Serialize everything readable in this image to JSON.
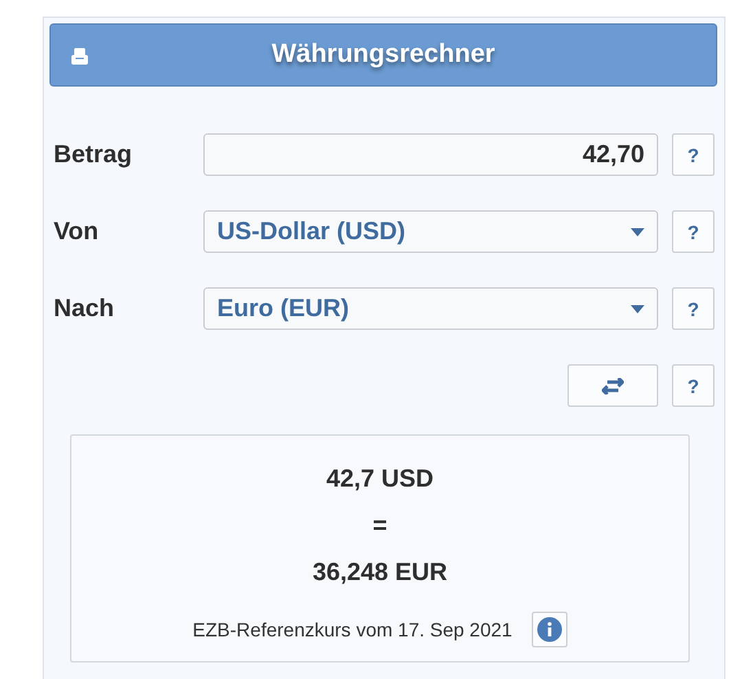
{
  "header": {
    "title": "Währungsrechner"
  },
  "fields": [
    {
      "kind": "input",
      "label": "Betrag",
      "value": "42,70",
      "help": "?"
    },
    {
      "kind": "select",
      "label": "Von",
      "value": "US-Dollar (USD)",
      "help": "?"
    },
    {
      "kind": "select",
      "label": "Nach",
      "value": "Euro (EUR)",
      "help": "?"
    }
  ],
  "swap": {
    "help": "?"
  },
  "result": {
    "from": "42,7 USD",
    "equals": "=",
    "to": "36,248 EUR",
    "note": "EZB-Referenzkurs vom 17. Sep 2021"
  }
}
